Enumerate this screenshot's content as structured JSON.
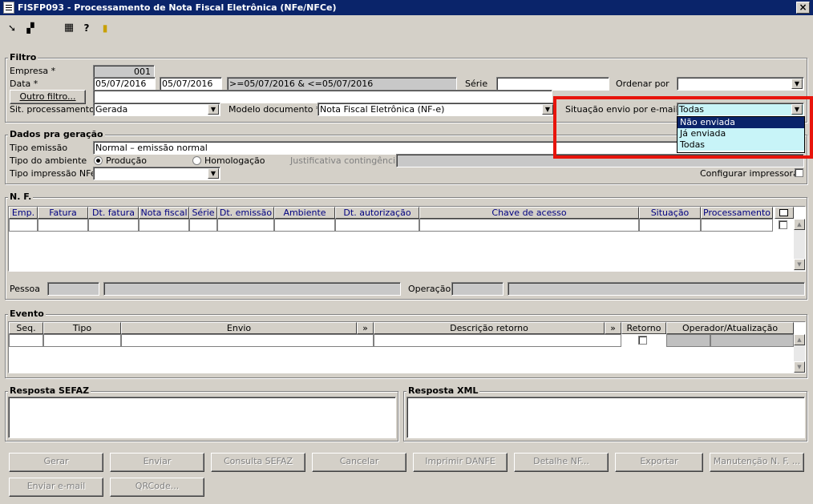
{
  "window": {
    "title": "FISFP093 - Processamento de Nota Fiscal Eletrônica (NFe/NFCe)",
    "close": "×"
  },
  "toolbar": {
    "icons": [
      "arrow-in-icon",
      "windows-icon",
      "calculator-icon",
      "help-icon",
      "exit-door-icon"
    ]
  },
  "filtro": {
    "title": "Filtro",
    "empresa_label": "Empresa *",
    "empresa_value": "001",
    "data_label": "Data *",
    "data_de": "05/07/2016",
    "data_ate": "05/07/2016",
    "data_expr": ">=05/07/2016 & <=05/07/2016",
    "serie_label": "Série",
    "serie_value": "",
    "ordenar_label": "Ordenar por",
    "ordenar_value": "",
    "outro_filtro": "Outro filtro...",
    "outro_filtro_value": "",
    "sit_label": "Sit. processamento",
    "sit_value": "Gerada",
    "modelo_label": "Modelo documento *",
    "modelo_value": "Nota Fiscal Eletrônica (NF-e)",
    "envio_label": "Situação envio por e-mail",
    "envio_value": "Todas",
    "envio_options": [
      "Não enviada",
      "Já enviada",
      "Todas"
    ],
    "envio_selected": "Não enviada"
  },
  "dados": {
    "title": "Dados pra geração",
    "tipo_emissao_label": "Tipo emissão",
    "tipo_emissao_value": "Normal – emissão normal",
    "ambiente_label": "Tipo do ambiente",
    "producao": "Produção",
    "homologacao": "Homologação",
    "ambiente_selected": "Produção",
    "justificativa_label": "Justificativa contingência",
    "justificativa_value": "",
    "impressao_label": "Tipo impressão NFe",
    "impressao_value": "",
    "config_impressora": "Configurar impressora",
    "config_impressora_checked": false
  },
  "nf": {
    "title": "N. F.",
    "columns": [
      "Emp.",
      "Fatura",
      "Dt. fatura",
      "Nota fiscal",
      "Série",
      "Dt. emissão",
      "Ambiente",
      "Dt. autorização",
      "Chave de acesso",
      "Situação",
      "Processamento"
    ],
    "pessoa_label": "Pessoa",
    "operacao_label": "Operação"
  },
  "evento": {
    "title": "Evento",
    "columns": [
      "Seq.",
      "Tipo",
      "Envio",
      "»",
      "Descrição retorno",
      "»",
      "Retorno",
      "Operador/Atualização"
    ]
  },
  "resposta_sefaz": {
    "title": "Resposta SEFAZ",
    "value": ""
  },
  "resposta_xml": {
    "title": "Resposta XML",
    "value": ""
  },
  "buttons": [
    "Gerar",
    "Enviar",
    "Consulta SEFAZ",
    "Cancelar",
    "Imprimir DANFE",
    "Detalhe NF...",
    "Exportar",
    "Manutenção N. F. ...",
    "Enviar e-mail",
    "QRCode..."
  ],
  "highlight_color": "#e8140c",
  "selection_color": "#0a246a",
  "dropdown_color": "#ffffff"
}
